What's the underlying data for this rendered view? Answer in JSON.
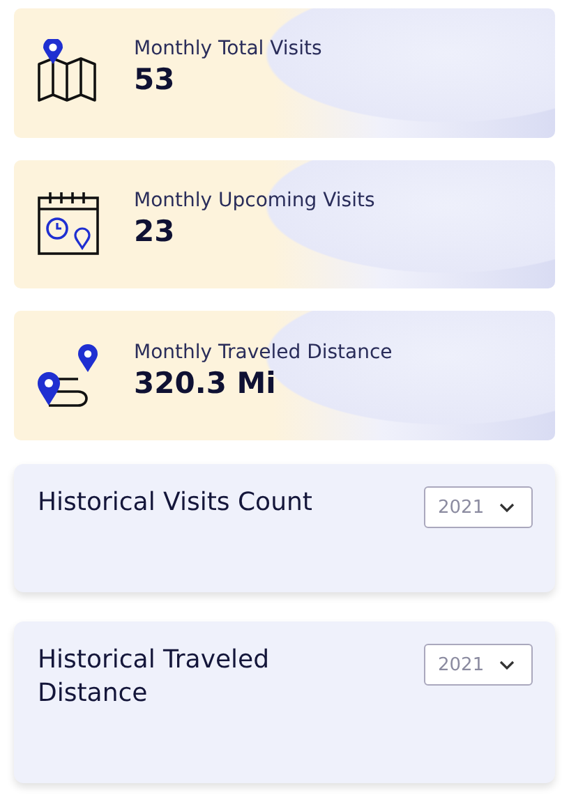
{
  "stats": [
    {
      "kind": "map",
      "label": "Monthly Total Visits",
      "value": "53"
    },
    {
      "kind": "calendar",
      "label": "Monthly Upcoming Visits",
      "value": "23"
    },
    {
      "kind": "route",
      "label": "Monthly Traveled Distance",
      "value": "320.3 Mi"
    }
  ],
  "panels": [
    {
      "title": "Historical Visits Count",
      "year": "2021"
    },
    {
      "title": "Historical Traveled Distance",
      "year": "2021"
    }
  ]
}
